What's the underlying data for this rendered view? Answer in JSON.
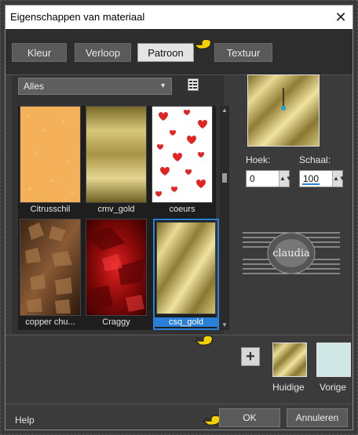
{
  "window": {
    "title": "Eigenschappen van materiaal"
  },
  "tabs": [
    {
      "label": "Kleur",
      "active": false
    },
    {
      "label": "Verloop",
      "active": false
    },
    {
      "label": "Patroon",
      "active": true
    },
    {
      "label": "Textuur",
      "active": false
    }
  ],
  "category_select": {
    "value": "Alles"
  },
  "patterns": [
    {
      "name": "Citrusschil",
      "style": "orange"
    },
    {
      "name": "cmv_gold",
      "style": "gold-horizontal"
    },
    {
      "name": "coeurs",
      "style": "hearts"
    },
    {
      "name": "copper chu...",
      "style": "copper"
    },
    {
      "name": "Craggy",
      "style": "red"
    },
    {
      "name": "csq_gold",
      "style": "gold-diagonal",
      "selected": true
    }
  ],
  "angle": {
    "label": "Hoek:",
    "value": "0"
  },
  "scale": {
    "label": "Schaal:",
    "value": "100"
  },
  "current_label": "Huidige",
  "previous_label": "Vorige",
  "buttons": {
    "help": "Help",
    "ok": "OK",
    "cancel": "Annuleren"
  },
  "logo_text": "claudia",
  "colors": {
    "accent": "#2a7fd6",
    "gold": "#c9b257",
    "previous_swatch": "#cfe8e6"
  }
}
